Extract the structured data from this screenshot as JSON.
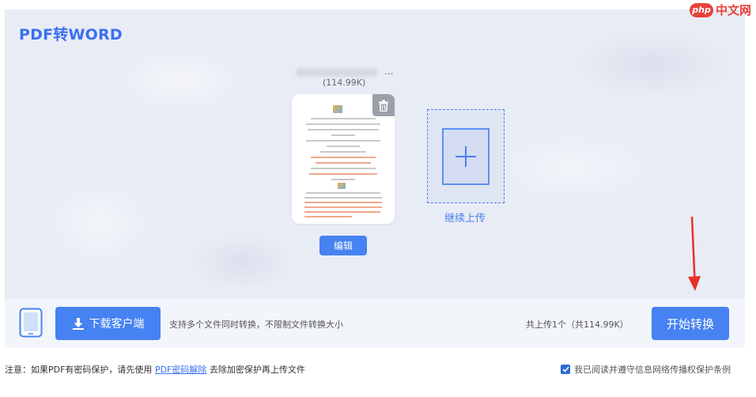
{
  "title": "PDF转WORD",
  "file": {
    "name_suffix": "...",
    "size": "(114.99K)"
  },
  "edit_label": "编辑",
  "upload_more_label": "继续上传",
  "bottom": {
    "download_label": "下载客户端",
    "support_text": "支持多个文件同时转换，不限制文件转换大小",
    "total_text": "共上传1个（共114.99K）",
    "start_label": "开始转换"
  },
  "note": {
    "prefix": "注意：如果PDF有密码保护，请先使用 ",
    "link": "PDF密码解除",
    "suffix": " 去除加密保护再上传文件"
  },
  "agree_text": "我已阅读并遵守信息网络传播权保护条例",
  "agree_checked": true,
  "watermark": {
    "badge": "php",
    "text": "中文网"
  },
  "colors": {
    "accent": "#4682f2",
    "title": "#3a6ff2",
    "arrow": "#e8302a"
  }
}
